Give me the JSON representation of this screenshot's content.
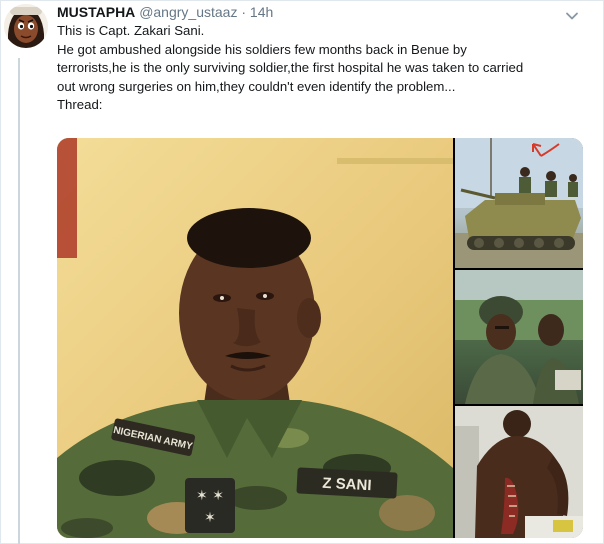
{
  "tweet": {
    "author_name": "MUSTAPHA",
    "handle": "@angry_ustaaz",
    "separator": "·",
    "time": "14h",
    "lines": [
      "This is Capt. Zakari Sani.",
      "He got ambushed alongside his soldiers few months back in Benue by",
      "terrorists,he is the only surviving soldier,the first hospital he was taken to carried",
      "out wrong surgeries on him,they couldn't even identify the problem...",
      "Thread:"
    ]
  },
  "photo_main": {
    "name_tag": "Z  SANI",
    "shoulder_tag": "NIGERIAN ARMY"
  },
  "icons": {
    "more_menu": "chevron-down-icon",
    "avatar": "avatar-cartoon"
  }
}
